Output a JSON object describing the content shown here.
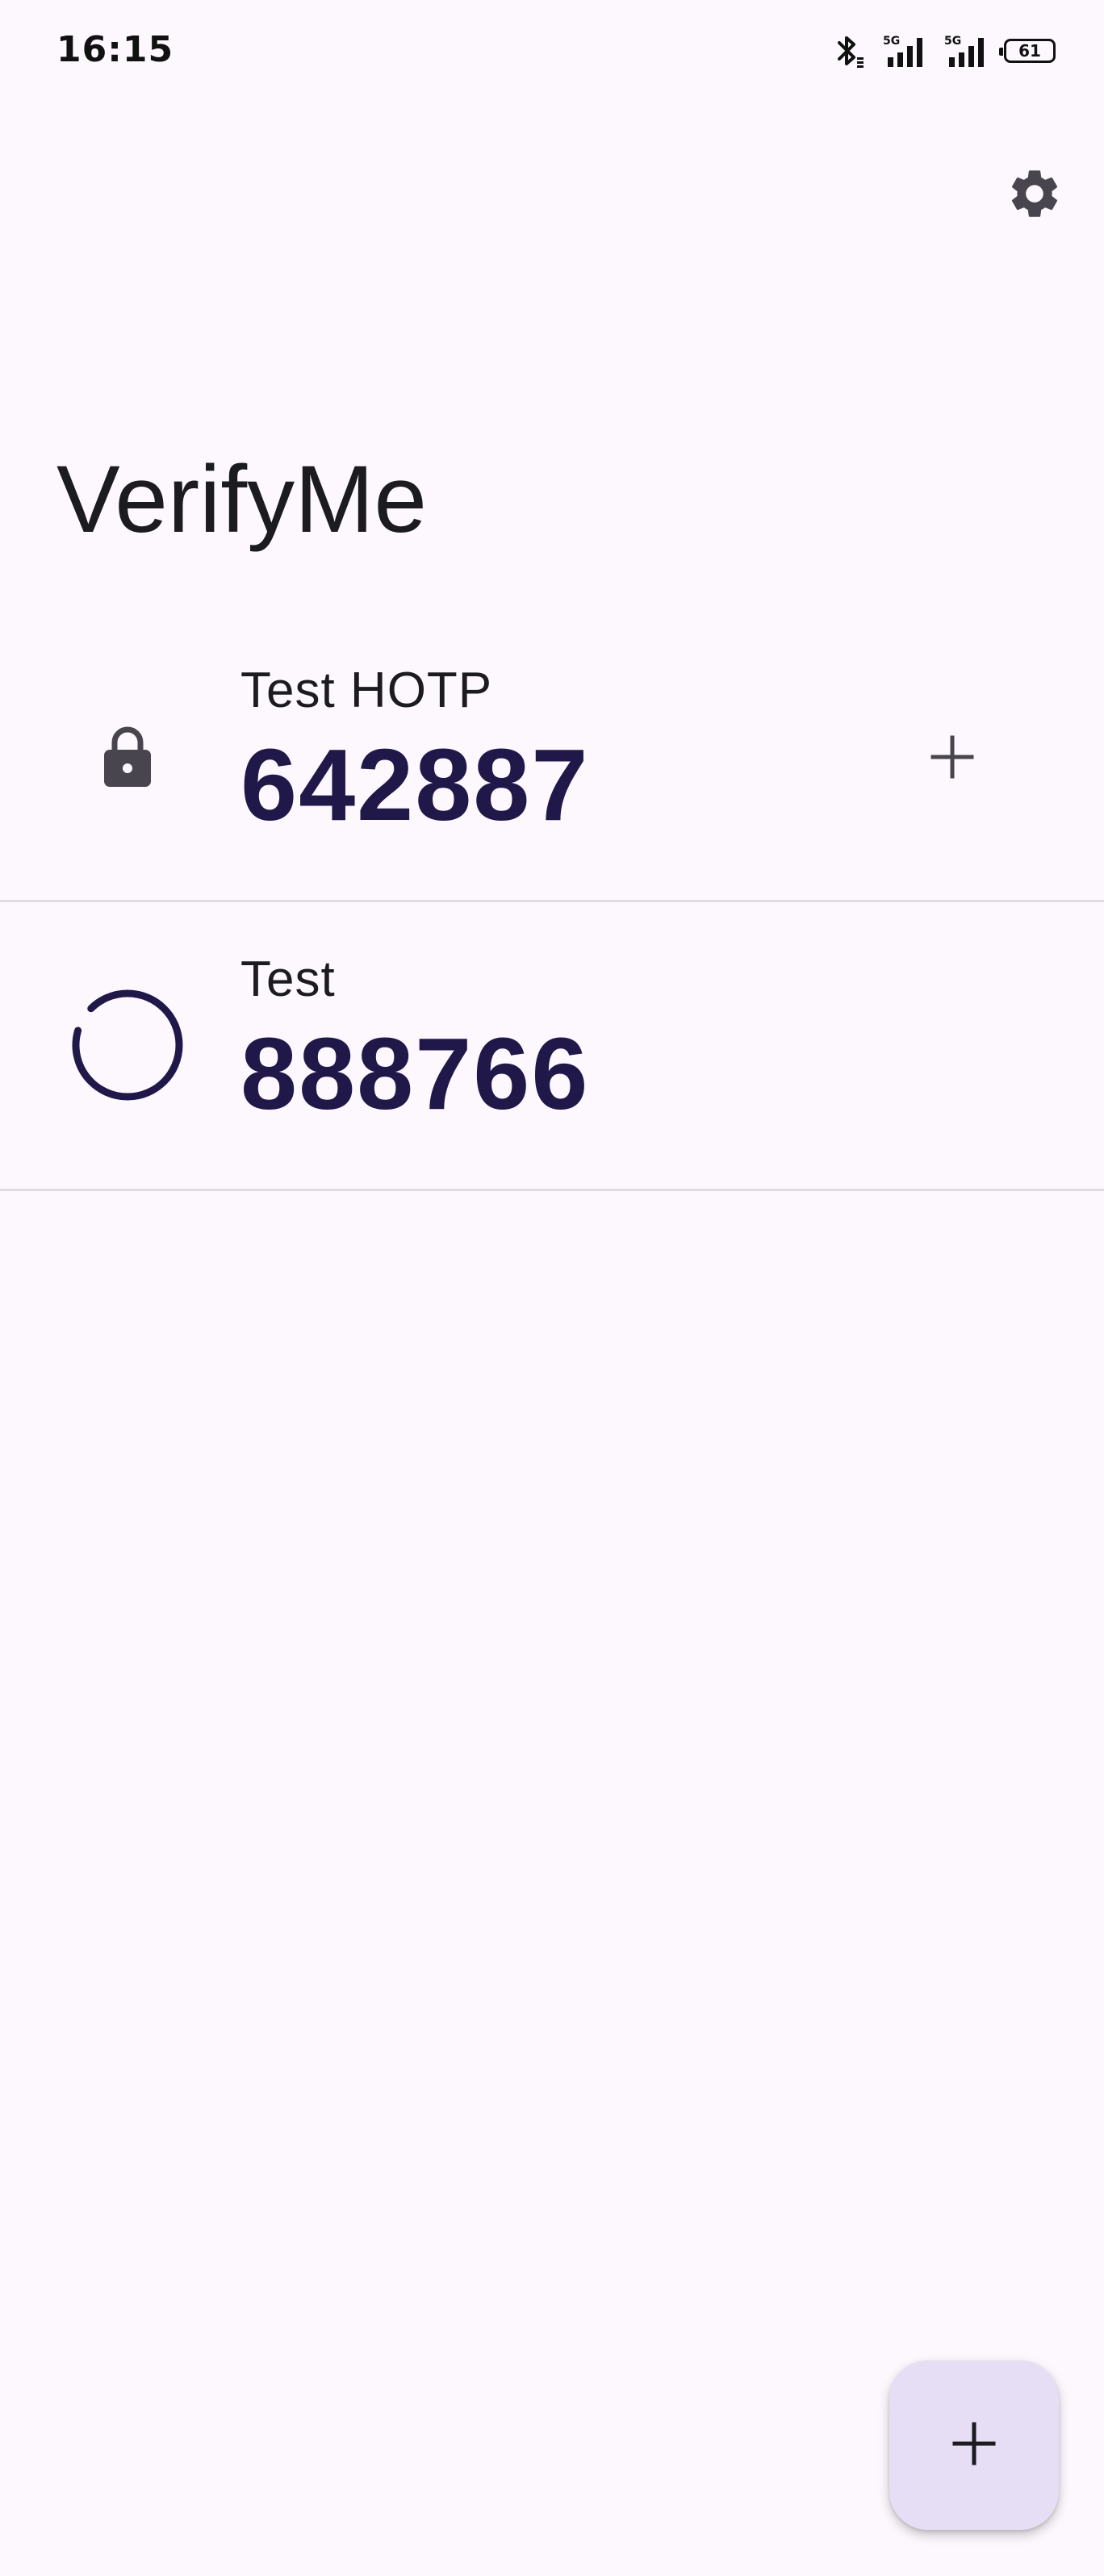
{
  "status_bar": {
    "time": "16:15",
    "battery_level": "61",
    "network_1": "5G",
    "network_2": "5G",
    "icons": [
      "bluetooth-icon",
      "signal-5g-icon",
      "signal-5g-icon",
      "battery-icon"
    ]
  },
  "app_bar": {
    "title": "VerifyMe",
    "settings_icon": "gear-icon"
  },
  "tokens": [
    {
      "name": "Test HOTP",
      "code": "642887",
      "leading_icon": "lock-icon",
      "action_icon": "plus-icon"
    },
    {
      "name": "Test",
      "code": "888766",
      "leading_icon": "countdown-progress-icon",
      "progress": 0.92
    }
  ],
  "fab": {
    "icon": "plus-icon"
  },
  "colors": {
    "background": "#fdf8fd",
    "code_text": "#21184a",
    "fab_background": "#e6def5",
    "divider": "#dedbe2",
    "icon": "#49454f"
  }
}
